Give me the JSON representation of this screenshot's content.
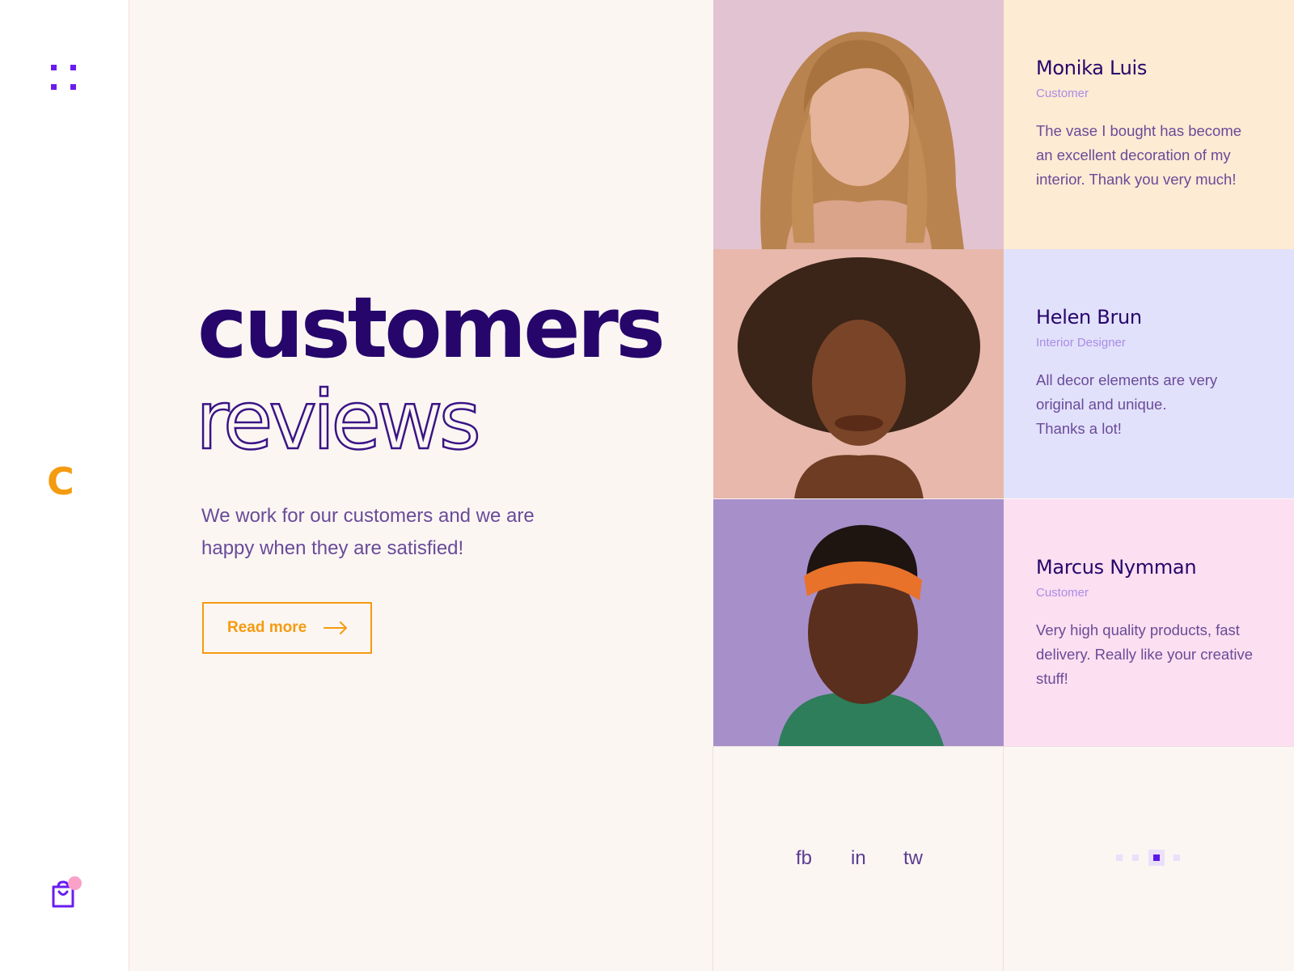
{
  "brand": {
    "logo_letter": "C",
    "accent": "#f59b0f",
    "primary": "#26066b",
    "menu_icon": "grid-dots-icon",
    "cart_icon": "shopping-bag-icon"
  },
  "hero": {
    "title_line1": "customers",
    "title_line2": "reviews",
    "subtitle": "We work for our customers and we are happy when they are satisfied!",
    "button_label": "Read more",
    "button_icon": "arrow-right-icon"
  },
  "reviews": [
    {
      "name": "Monika Luis",
      "role": "Customer",
      "quote": "The vase I bought has become an excellent decoration of my interior. Thank you very much!",
      "card_bg": "#fdebd3",
      "photo_bg": "#e2c3d2"
    },
    {
      "name": "Helen Brun",
      "role": "Interior Designer",
      "quote": "All decor elements are very original and unique.\nThanks a lot!",
      "card_bg": "#e2e1fb",
      "photo_bg": "#e7b8ab"
    },
    {
      "name": "Marcus Nymman",
      "role": "Customer",
      "quote": "Very high quality products, fast delivery. Really like your creative stuff!",
      "card_bg": "#fcdff0",
      "photo_bg": "#a78fca"
    }
  ],
  "social": {
    "fb": "fb",
    "in": "in",
    "tw": "tw"
  },
  "pager": {
    "count": 4,
    "active_index": 3
  }
}
